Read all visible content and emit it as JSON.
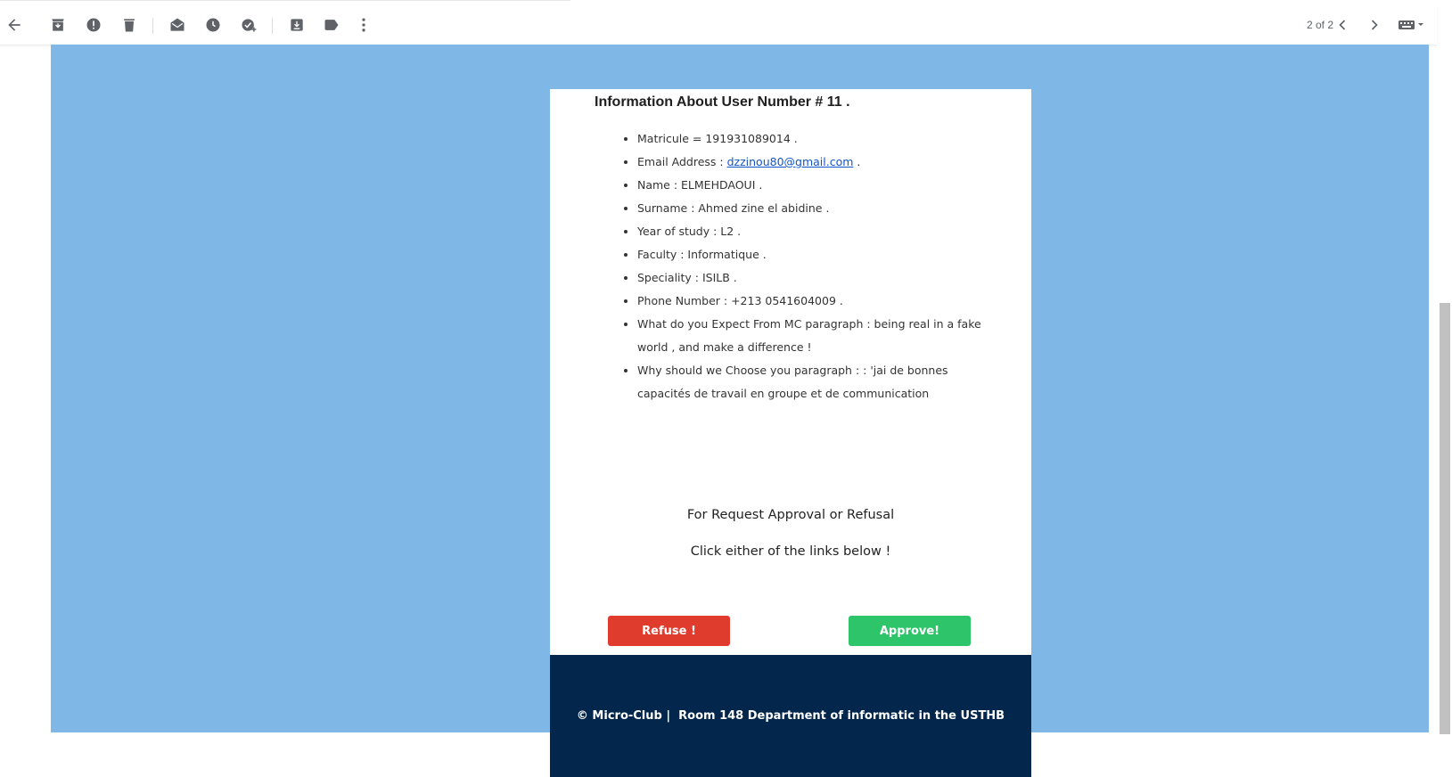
{
  "toolbar": {
    "pager_text": "2 of 2",
    "icons": [
      "back-arrow-icon",
      "archive-icon",
      "report-spam-icon",
      "delete-icon",
      "mark-unread-icon",
      "snooze-icon",
      "add-task-icon",
      "move-to-icon",
      "label-icon",
      "more-icon",
      "previous-icon",
      "next-icon",
      "keyboard-icon"
    ]
  },
  "email": {
    "heading": "Information About User Number # 11 .",
    "items": {
      "matricule": "Matricule = 191931089014 .",
      "email_prefix": "Email Address : ",
      "email_link": "dzzinou80@gmail.com",
      "email_suffix": " .",
      "name": "Name : ELMEHDAOUI .",
      "surname": "Surname : Ahmed zine el abidine .",
      "year": "Year of study : L2 .",
      "faculty": "Faculty : Informatique .",
      "speciality": "Speciality : ISILB .",
      "phone": "Phone Number : +213 0541604009 .",
      "expect": "What do you Expect From MC paragraph : being real in a fake world , and make a difference !",
      "why": "Why should we Choose you paragraph : : 'jai de bonnes capacités de travail en groupe et de communication"
    },
    "request_line1": "For Request Approval or Refusal",
    "request_line2": "Click either of the links  below !",
    "refuse_label": "Refuse !",
    "approve_label": "Approve!",
    "footer_text": "© Micro-Club |  Room 148 Department of informatic in the USTHB"
  },
  "colors": {
    "background_blue": "#7fb8e6",
    "footer_navy": "#03274c",
    "refuse_red": "#e03c2d",
    "approve_green": "#2ec46a",
    "link_blue": "#1155cc"
  }
}
